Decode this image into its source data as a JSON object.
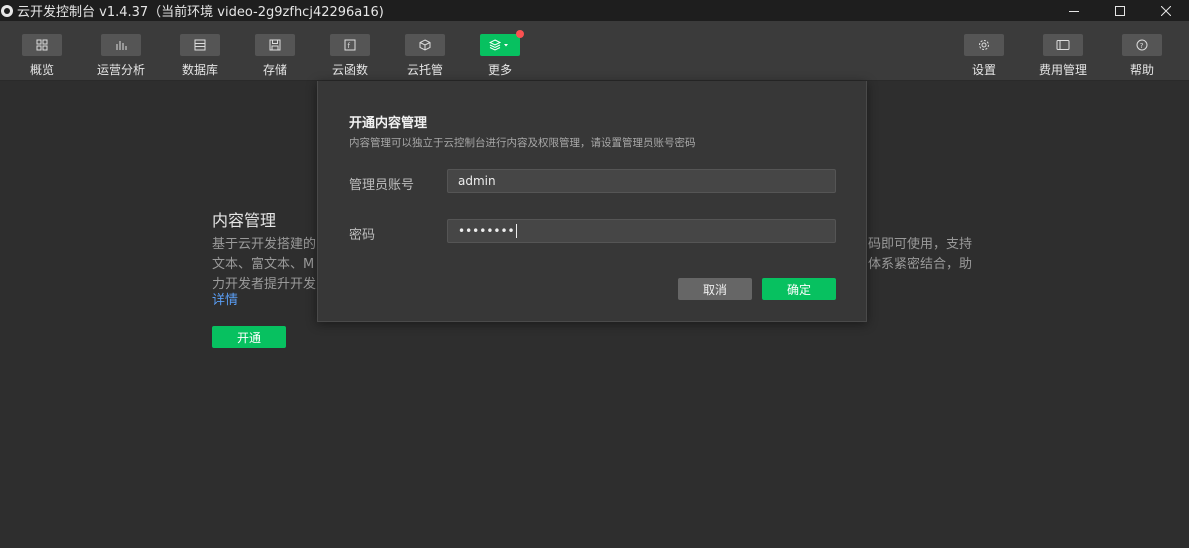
{
  "window": {
    "title": "云开发控制台 v1.4.37（当前环境 video-2g9zfhcj42296a16)"
  },
  "toolbar": {
    "left_items": [
      {
        "label": "概览",
        "icon": "overview-icon"
      },
      {
        "label": "运营分析",
        "icon": "analytics-icon"
      },
      {
        "label": "数据库",
        "icon": "database-icon"
      },
      {
        "label": "存储",
        "icon": "storage-icon"
      },
      {
        "label": "云函数",
        "icon": "function-icon"
      },
      {
        "label": "云托管",
        "icon": "hosting-icon"
      },
      {
        "label": "更多",
        "icon": "layers-icon"
      }
    ],
    "right_items": [
      {
        "label": "设置",
        "icon": "gear-icon"
      },
      {
        "label": "费用管理",
        "icon": "billing-icon"
      },
      {
        "label": "帮助",
        "icon": "help-icon"
      }
    ],
    "accent_color": "#07c160",
    "badge_color": "#fa5151"
  },
  "background": {
    "title": "内容管理",
    "desc_line1_left": "基于云开发搭建的",
    "desc_line1_right": "码即可使用，支持",
    "desc_line2_left": "文本、富文本、M",
    "desc_line2_right": "体系紧密结合，助",
    "desc_line3_left": "力开发者提升开发",
    "link": "详情",
    "open_button": "开通"
  },
  "dialog": {
    "title": "开通内容管理",
    "subtitle": "内容管理可以独立于云控制台进行内容及权限管理，请设置管理员账号密码",
    "account_label": "管理员账号",
    "account_value": "admin",
    "password_label": "密码",
    "password_value": "••••••••",
    "cancel": "取消",
    "confirm": "确定"
  }
}
